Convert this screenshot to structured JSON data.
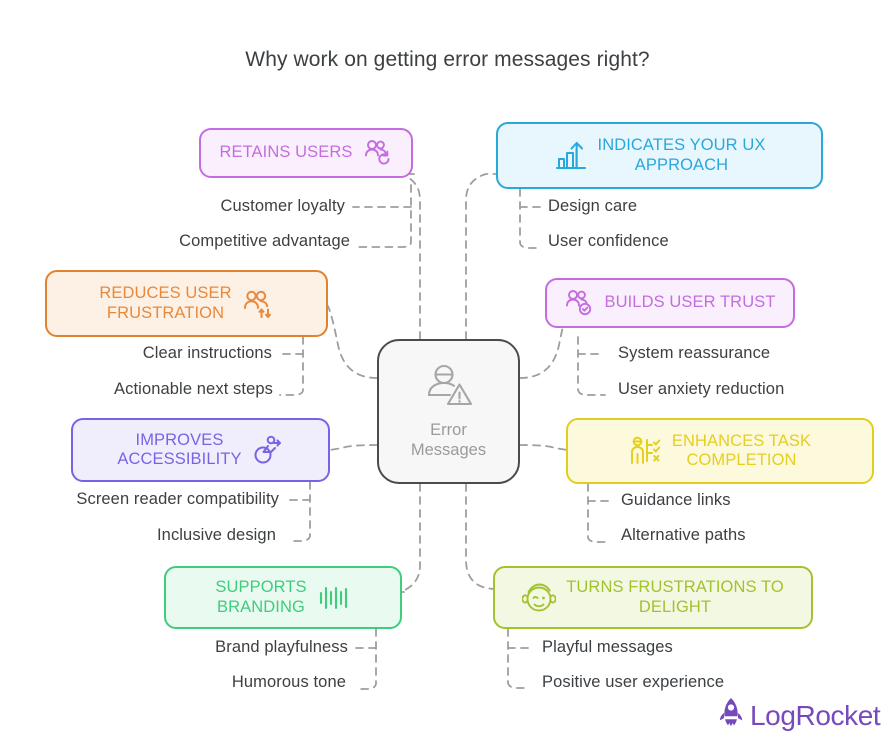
{
  "title": "Why work on getting error messages right?",
  "colors": {
    "title_text": "#3c4043",
    "leaf_text": "#3c4043",
    "connector": "#9e9e9e",
    "center_border": "#4b4b4b",
    "center_fill": "#f7f7f7",
    "center_text": "#9b9b9b",
    "logo_purple": "#764abc"
  },
  "center": {
    "label": "Error\nMessages",
    "icon": "user-warning-icon"
  },
  "branches": [
    {
      "id": "retains-users",
      "label": "RETAINS USERS",
      "icon": "users-refresh-icon",
      "color": "#c46ce0",
      "border": "#c46ce0",
      "fill": "#faf0fd",
      "children": [
        "Customer loyalty",
        "Competitive advantage"
      ]
    },
    {
      "id": "indicates-ux-approach",
      "label": "INDICATES YOUR UX\nAPPROACH",
      "icon": "growth-chart-arrow-icon",
      "color": "#29a8dc",
      "border": "#29a8dc",
      "fill": "#e8f7fd",
      "children": [
        "Design care",
        "User confidence"
      ]
    },
    {
      "id": "reduces-user-frustration",
      "label": "REDUCES USER\nFRUSTRATION",
      "icon": "users-updown-arrows-icon",
      "color": "#e8893c",
      "border": "#e0832f",
      "fill": "#fdf0e4",
      "children": [
        "Clear instructions",
        "Actionable next steps"
      ]
    },
    {
      "id": "builds-user-trust",
      "label": "BUILDS USER TRUST",
      "icon": "users-check-icon",
      "color": "#c46ce0",
      "border": "#c46ce0",
      "fill": "#faf0fd",
      "children": [
        "System reassurance",
        "User anxiety reduction"
      ]
    },
    {
      "id": "improves-accessibility",
      "label": "IMPROVES\nACCESSIBILITY",
      "icon": "wheelchair-arrow-icon",
      "color": "#7764e4",
      "border": "#7764e4",
      "fill": "#f0eefd",
      "children": [
        "Screen reader compatibility",
        "Inclusive design"
      ]
    },
    {
      "id": "enhances-task-completion",
      "label": "ENHANCES TASK\nCOMPLETION",
      "icon": "person-checklist-icon",
      "color": "#e8d game",
      "border": "#e2ce20",
      "fill": "#fcf9dd",
      "children": [
        "Guidance links",
        "Alternative paths"
      ]
    },
    {
      "id": "supports-branding",
      "label": "SUPPORTS\nBRANDING",
      "icon": "sound-wave-icon",
      "color": "#3fcc7c",
      "border": "#3fcc7c",
      "fill": "#e9fbf0",
      "children": [
        "Brand playfulness",
        "Humorous tone"
      ]
    },
    {
      "id": "turns-frustrations-to-delight",
      "label": "TURNS FRUSTRATIONS TO\nDELIGHT",
      "icon": "winking-face-icon",
      "color": "#a2c22e",
      "border": "#a2c22e",
      "fill": "#f3f8e2",
      "children": [
        "Playful messages",
        "Positive user experience"
      ]
    }
  ],
  "logo": {
    "text": "LogRocket",
    "icon": "rocket-icon"
  }
}
